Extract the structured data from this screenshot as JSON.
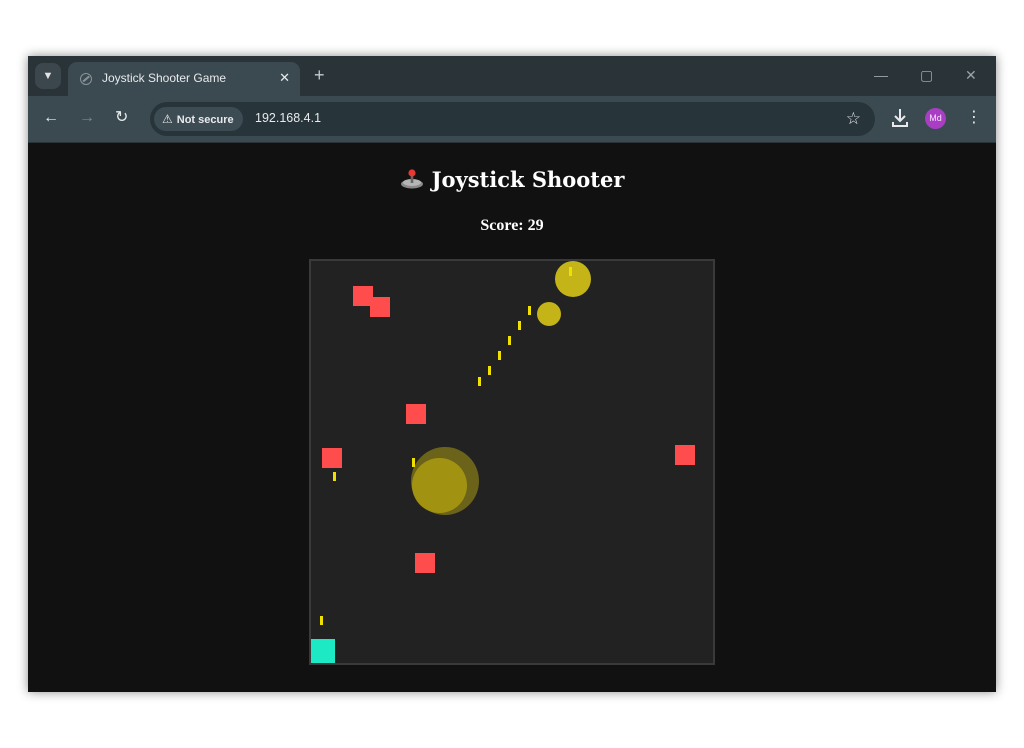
{
  "browser": {
    "tab_title": "Joystick Shooter Game",
    "new_tab_symbol": "+",
    "close_tab_symbol": "✕",
    "security_label": "Not secure",
    "url": "192.168.4.1",
    "avatar_initials": "Md",
    "icons": [
      "tab-search-icon",
      "favicon-icon",
      "back-icon",
      "forward-icon",
      "reload-icon",
      "warning-icon",
      "star-icon",
      "download-icon",
      "menu-icon",
      "minimize-icon",
      "maximize-icon",
      "close-icon"
    ]
  },
  "game": {
    "title": "Joystick Shooter",
    "score_text": "Score: 29",
    "colors": {
      "background": "#111111",
      "canvas": "#222222",
      "enemy": "#ff4c4c",
      "bullet": "#f0e000",
      "player": "#1de9c4"
    }
  }
}
